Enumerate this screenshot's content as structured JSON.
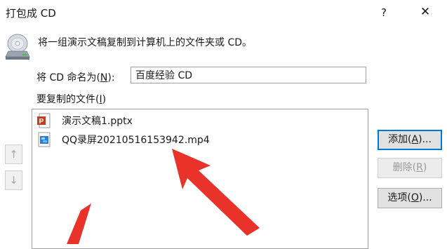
{
  "window": {
    "title": "打包成 CD",
    "help_label": "?",
    "close_label": "✕"
  },
  "description": "将一组演示文稿复制到计算机上的文件夹或 CD。",
  "name_field": {
    "label_prefix": "将 CD 命名为(",
    "label_accel": "N",
    "label_suffix": "):",
    "value": "百度经验 CD"
  },
  "files": {
    "label_prefix": "要复制的文件(",
    "label_accel": "I",
    "label_suffix": ")",
    "items": [
      {
        "name": "演示文稿1.pptx",
        "icon": "pptx-file-icon"
      },
      {
        "name": "QQ录屏20210516153942.mp4",
        "icon": "video-file-icon"
      }
    ]
  },
  "reorder": {
    "up_label": "↑",
    "down_label": "↓"
  },
  "buttons": {
    "add": {
      "prefix": "添加(",
      "accel": "A",
      "suffix": ")..."
    },
    "remove": {
      "prefix": "删除(",
      "accel": "R",
      "suffix": ")"
    },
    "options": {
      "prefix": "选项(",
      "accel": "O",
      "suffix": ")..."
    }
  },
  "colors": {
    "annotation_arrow": "#e8322a",
    "accent_border": "#0078d7",
    "pptx_icon": "#c43e1c",
    "video_icon": "#2b7cd3"
  }
}
